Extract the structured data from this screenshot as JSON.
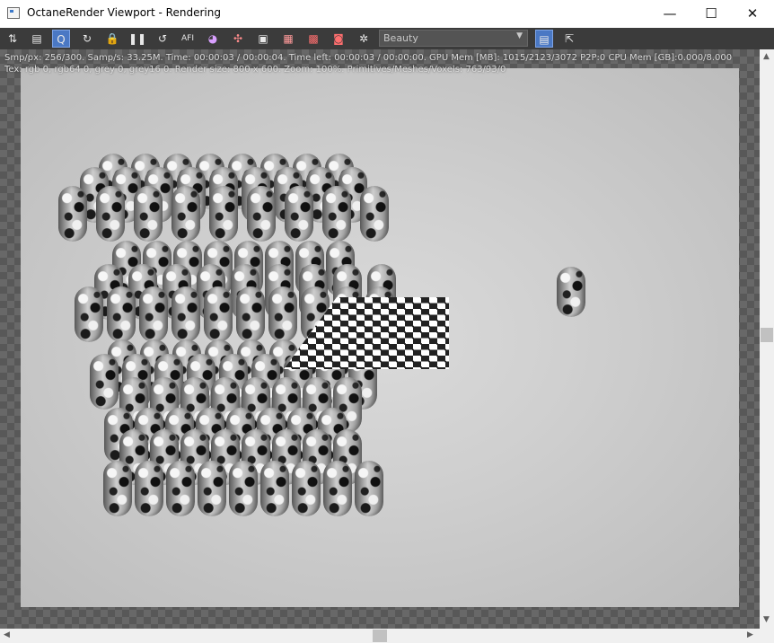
{
  "window": {
    "title": "OctaneRender Viewport - Rendering",
    "buttons": {
      "minimize": "—",
      "maximize": "☐",
      "close": "✕"
    }
  },
  "toolbar": {
    "icons": [
      "⇅",
      "▤",
      "Q",
      "↻",
      "🔒",
      "❚❚",
      "↺",
      "AFI",
      "◕",
      "✣",
      "▣",
      "▦",
      "▩",
      "◙",
      "✲"
    ],
    "render_pass": "Beauty",
    "right_icons": [
      "▤",
      "⇱"
    ]
  },
  "status": {
    "line1": "Smp/px: 256/300.   Samp/s: 33.25M.   Time: 00:00:03 / 00:00:04.   Time left: 00:00:03 / 00:00:00.   GPU Mem [MB]: 1015/2123/3072 P2P:0   CPU Mem [GB]:0.000/8.000",
    "line2": "Tex: rgb 0, rgb64 0, grey 0, grey16 0.   Render size: 800 x 600.   Zoom: 100%.   Primitives/Meshes/Voxels: 763/93/0"
  },
  "colors": {
    "toolbar_bg": "#3b3b3b",
    "active_accent": "#4a78c4",
    "render_bg": "#cfcfcf"
  }
}
